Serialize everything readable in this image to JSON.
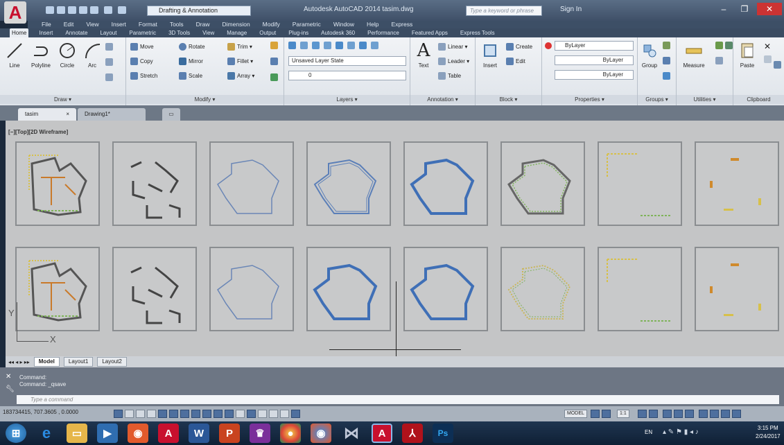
{
  "titlebar": {
    "workspace": "Drafting & Annotation",
    "app_title": "Autodesk AutoCAD 2014    tasim.dwg",
    "search_placeholder": "Type a keyword or phrase",
    "signin": "Sign In"
  },
  "menubar": [
    "File",
    "Edit",
    "View",
    "Insert",
    "Format",
    "Tools",
    "Draw",
    "Dimension",
    "Modify",
    "Parametric",
    "Window",
    "Help",
    "Express"
  ],
  "ribbon_tabs": [
    "Home",
    "Insert",
    "Annotate",
    "Layout",
    "Parametric",
    "3D Tools",
    "View",
    "Manage",
    "Output",
    "Plug-ins",
    "Autodesk 360",
    "Performance",
    "Featured Apps",
    "Express Tools"
  ],
  "draw": {
    "title": "Draw ▾",
    "line": "Line",
    "polyline": "Polyline",
    "circle": "Circle",
    "arc": "Arc"
  },
  "modify": {
    "title": "Modify ▾",
    "move": "Move",
    "rotate": "Rotate",
    "trim": "Trim ▾",
    "copy": "Copy",
    "mirror": "Mirror",
    "fillet": "Fillet ▾",
    "stretch": "Stretch",
    "scale": "Scale",
    "array": "Array ▾"
  },
  "layers": {
    "title": "Layers ▾",
    "state": "Unsaved Layer State",
    "current": "0"
  },
  "annotation": {
    "title": "Annotation ▾",
    "text": "Text",
    "linear": "Linear ▾",
    "leader": "Leader ▾",
    "table": "Table"
  },
  "block": {
    "title": "Block ▾",
    "insert": "Insert",
    "create": "Create",
    "edit": "Edit"
  },
  "properties": {
    "title": "Properties ▾",
    "color": "ByLayer",
    "linetype": "ByLayer",
    "lineweight": "ByLayer"
  },
  "groups": {
    "title": "Groups ▾",
    "group": "Group"
  },
  "utilities": {
    "title": "Utilities ▾",
    "measure": "Measure"
  },
  "clipboard": {
    "title": "Clipboard",
    "paste": "Paste"
  },
  "file_tabs": [
    "tasim",
    "Drawing1*"
  ],
  "viewport_label": "[−][Top][2D Wireframe]",
  "layout_tabs": [
    "Model",
    "Layout1",
    "Layout2"
  ],
  "command": {
    "line1": "Command:",
    "line2": "Command:  _qsave",
    "placeholder": "Type a command"
  },
  "status": {
    "coords": "183734415, 707.3605 , 0.0000",
    "model": "MODEL",
    "scale": "1:1"
  },
  "clock": {
    "time": "3:15 PM",
    "date": "2/24/2017"
  },
  "lang": "EN"
}
